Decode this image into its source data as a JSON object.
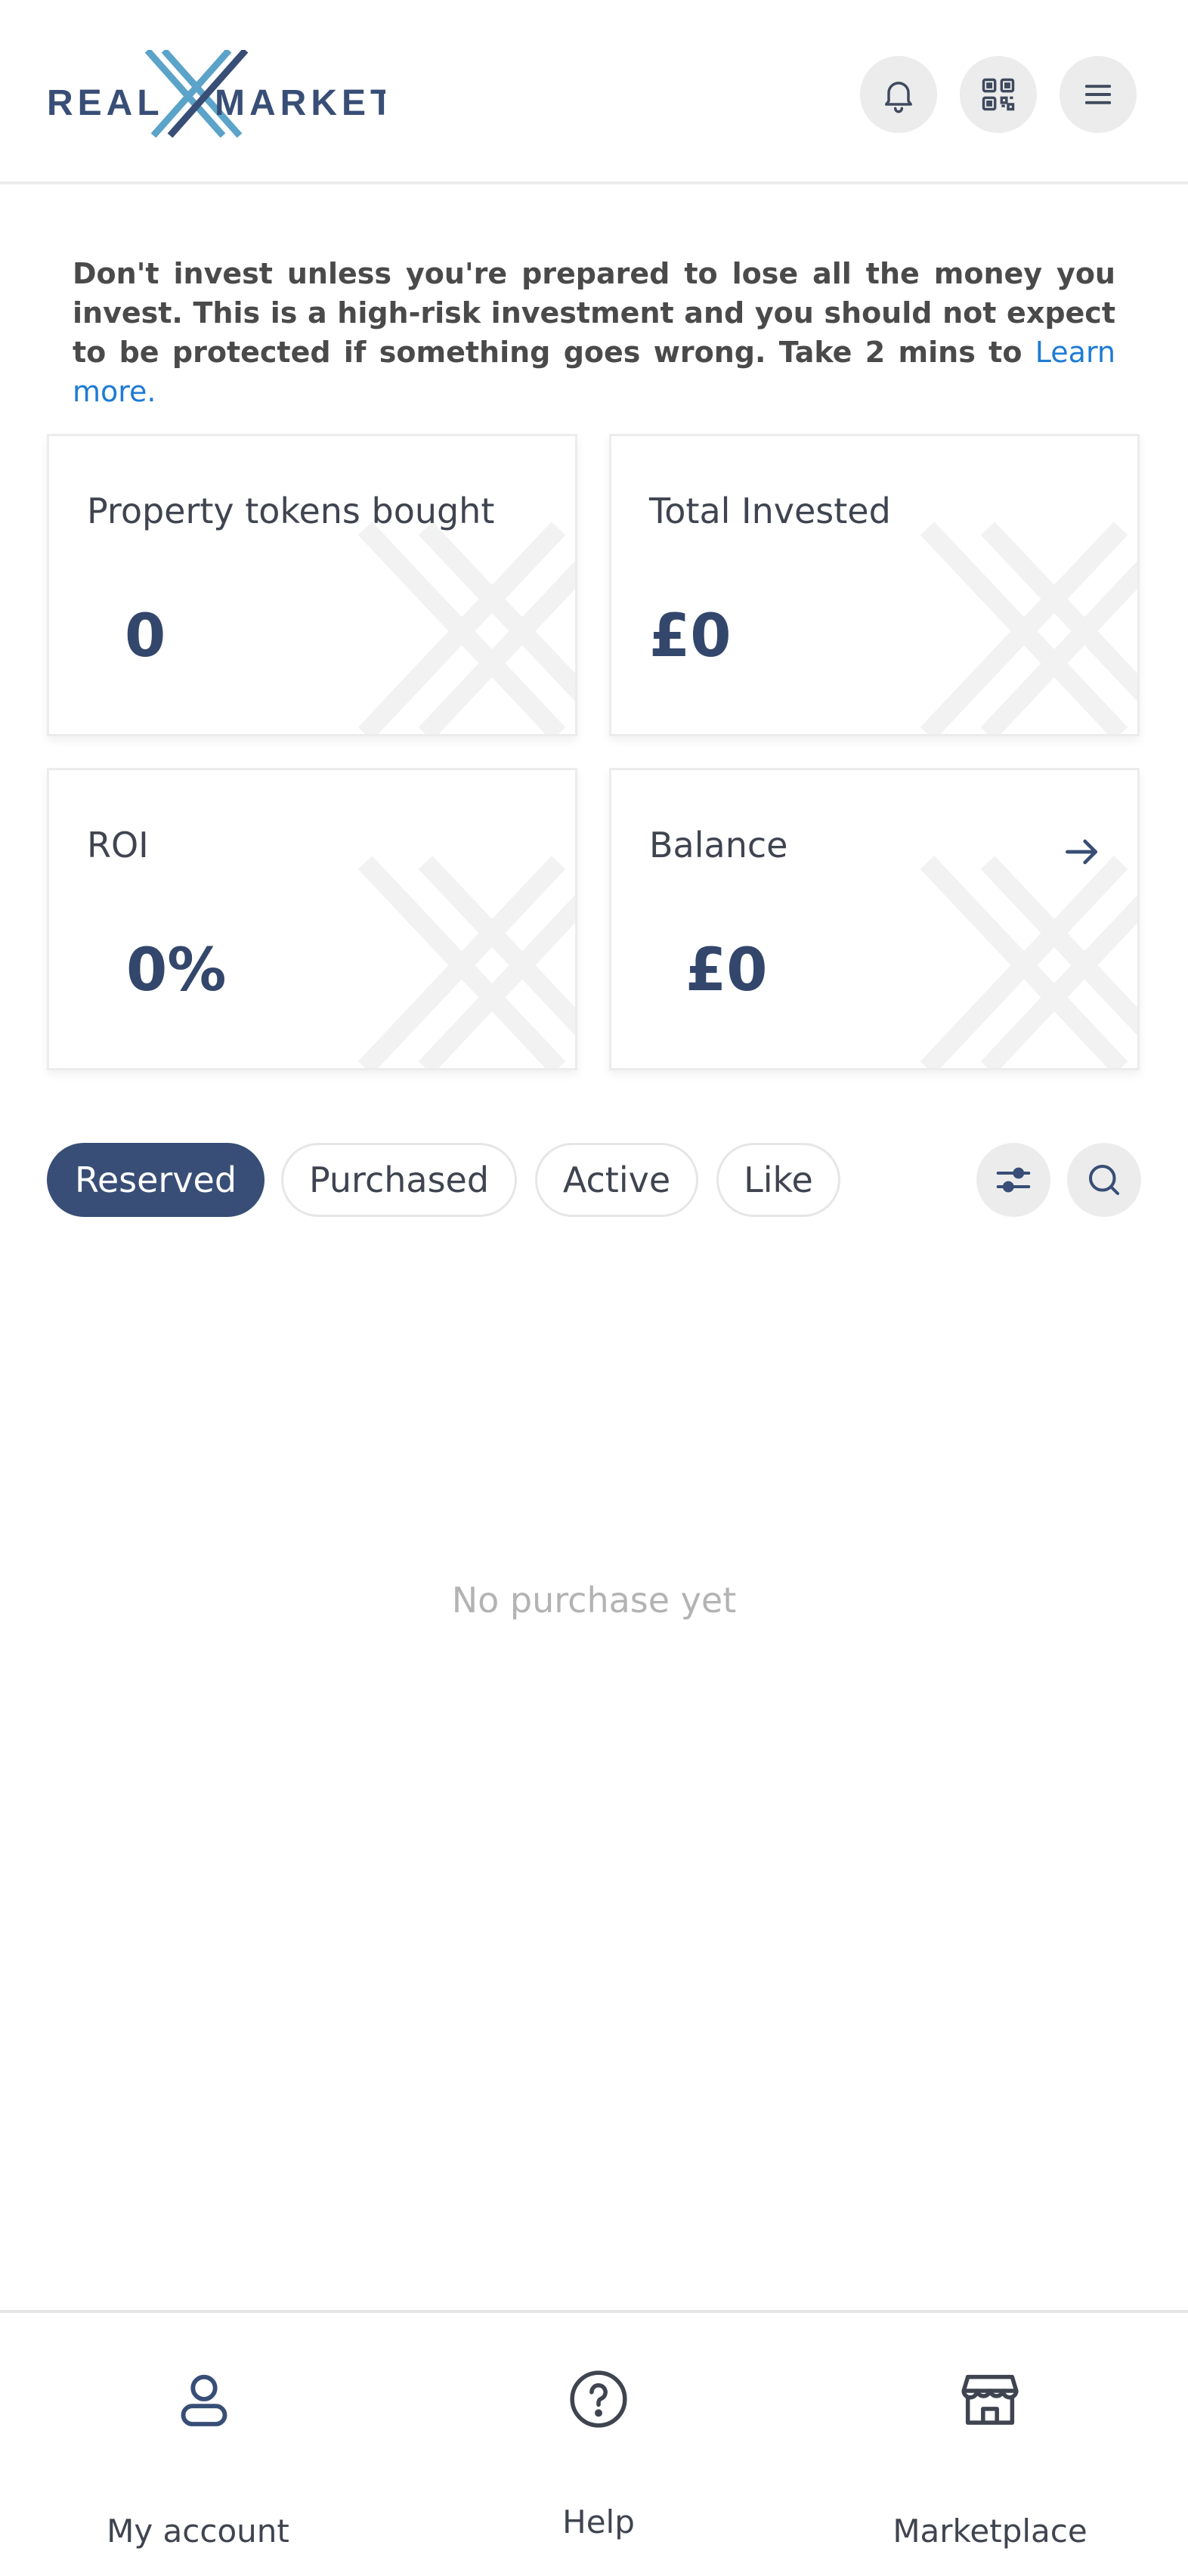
{
  "header": {
    "logo_text": "REALXMARKET",
    "notifications_icon": "bell-icon",
    "qr_icon": "qr-code-icon",
    "menu_icon": "hamburger-menu-icon"
  },
  "disclaimer": {
    "text": "Don't invest unless you're prepared to lose all the money you invest. This is a high-risk investment and you should not expect to be protected if something goes wrong. Take 2 mins to ",
    "link": "Learn more."
  },
  "stats": {
    "tokens": {
      "label": "Property tokens bought",
      "value": "0"
    },
    "invested": {
      "label": "Total Invested",
      "value": "£0"
    },
    "roi": {
      "label": "ROI",
      "value": "0%"
    },
    "balance": {
      "label": "Balance",
      "value": "£0",
      "icon": "arrow-right-icon"
    }
  },
  "tabs": {
    "reserved": "Reserved",
    "purchased": "Purchased",
    "active": "Active",
    "like": "Like",
    "selected": "Reserved"
  },
  "tools": {
    "filter_icon": "filter-sliders-icon",
    "search_icon": "search-icon"
  },
  "empty_state": "No purchase yet",
  "bottom_nav": {
    "account": {
      "label": "My account",
      "icon": "user-icon"
    },
    "help": {
      "label": "Help",
      "icon": "help-circle-icon"
    },
    "marketplace": {
      "label": "Marketplace",
      "icon": "store-icon"
    }
  },
  "colors": {
    "brand_navy": "#384e76",
    "brand_accent": "#5ba3c9",
    "link": "#1e7bd4",
    "value_text": "#33466b"
  }
}
